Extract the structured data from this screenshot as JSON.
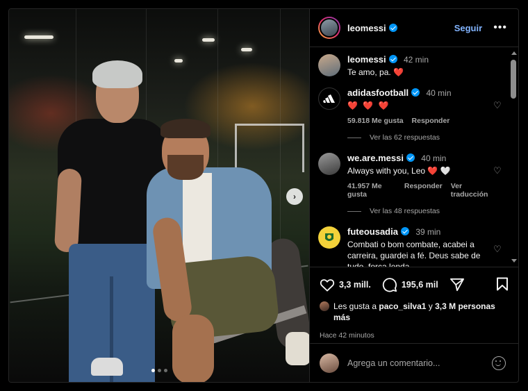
{
  "header": {
    "username": "leomessi",
    "follow_label": "Seguir",
    "more_label": "•••"
  },
  "caption": {
    "username": "leomessi",
    "time": "42 min",
    "text": "Te amo, pa. ❤️"
  },
  "comments": [
    {
      "username": "adidasfootball",
      "verified": true,
      "time": "40 min",
      "text": "❤️ ❤️ ❤️",
      "likes": "59.818 Me gusta",
      "reply_label": "Responder",
      "translate_label": "",
      "replies_label": "Ver las 62 respuestas"
    },
    {
      "username": "we.are.messi",
      "verified": true,
      "time": "40 min",
      "text": "Always with you, Leo ❤️ 🤍",
      "likes": "41.957 Me gusta",
      "reply_label": "Responder",
      "translate_label": "Ver traducción",
      "replies_label": "Ver las 48 respuestas"
    },
    {
      "username": "futeousadia",
      "verified": true,
      "time": "39 min",
      "text": "Combati o bom combate, acabei a carreira, guardei a fé. Deus sabe de tudo, força lenda"
    }
  ],
  "actions": {
    "likes_count": "3,3 mill.",
    "comments_count": "195,6 mil"
  },
  "liked_by": {
    "prefix": "Les gusta a",
    "user": "paco_silva1",
    "suffix": "y",
    "others": "3,3 M personas",
    "others_suffix": "más"
  },
  "posted": "Hace 42 minutos",
  "composer": {
    "placeholder": "Agrega un comentario..."
  },
  "carousel": {
    "total": 3,
    "current": 1
  },
  "colors": {
    "accent": "#0095f6",
    "follow": "#82b4ff",
    "heart": "#ed4956"
  }
}
